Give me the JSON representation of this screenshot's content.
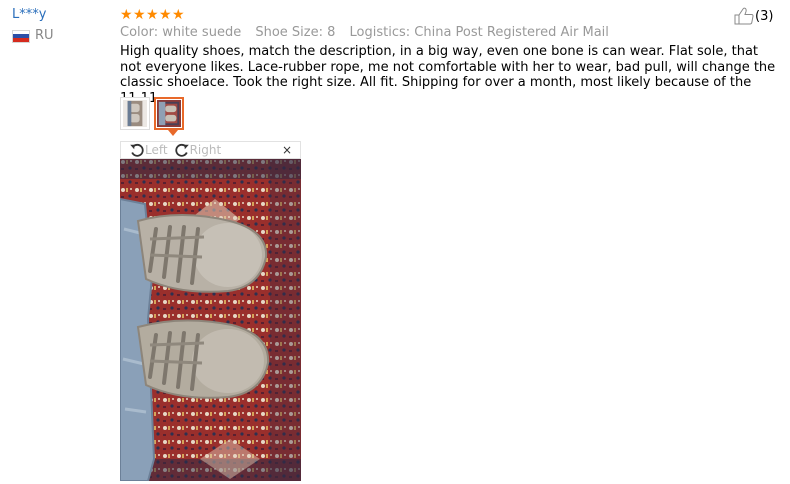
{
  "reviewer": {
    "name": "L***y",
    "country_code": "RU",
    "flag_colors": [
      "#ffffff",
      "#2c4fa7",
      "#d52b1e"
    ]
  },
  "rating": {
    "stars": 5,
    "max": 5,
    "star_color": "#ff8a00"
  },
  "attributes": [
    "Color: white suede",
    "Shoe Size: 8",
    "Logistics: China Post Registered Air Mail"
  ],
  "helpful": {
    "count": "(3)"
  },
  "review_text": "High quality shoes, match the description, in a big way, even one bone is can wear. Flat sole, that not everyone likes. Lace-rubber rope, me not comfortable with her to wear, bad pull, will change the classic shoelace. Took the right size. All fit. Shipping for over a month, most likely because of the 11.11",
  "photos": {
    "thumbnails": 2,
    "selected": 2,
    "viewer": {
      "rotate_left_label": "Left",
      "rotate_right_label": "Right",
      "close_glyph": "×"
    }
  },
  "colors": {
    "link": "#2a6ebb",
    "muted": "#999999",
    "accent": "#e8692a"
  }
}
